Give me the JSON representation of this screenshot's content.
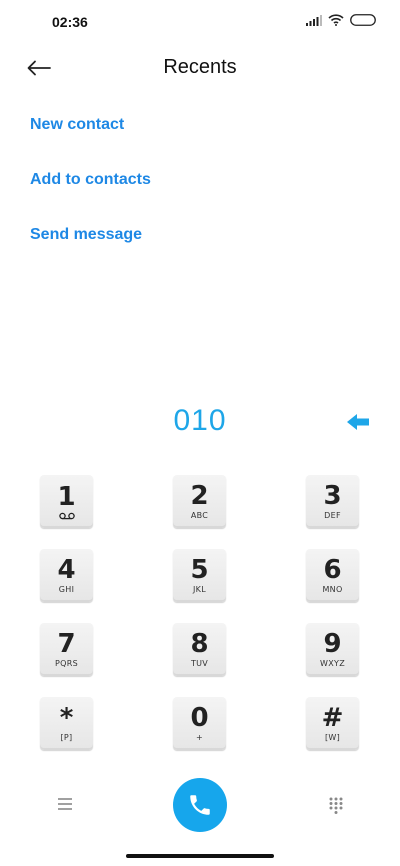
{
  "status_bar": {
    "time": "02:36",
    "icons": [
      "signal-icon",
      "wifi-icon",
      "battery-icon"
    ]
  },
  "header": {
    "title": "Recents",
    "back_icon": "back-arrow-icon"
  },
  "actions": [
    {
      "label": "New contact"
    },
    {
      "label": "Add to contacts"
    },
    {
      "label": "Send message"
    }
  ],
  "dialer": {
    "number": "010",
    "backspace_icon": "backspace-icon"
  },
  "keypad": [
    {
      "digit": "1",
      "letters": "",
      "icon": "voicemail-icon"
    },
    {
      "digit": "2",
      "letters": "ABC"
    },
    {
      "digit": "3",
      "letters": "DEF"
    },
    {
      "digit": "4",
      "letters": "GHI"
    },
    {
      "digit": "5",
      "letters": "JKL"
    },
    {
      "digit": "6",
      "letters": "MNO"
    },
    {
      "digit": "7",
      "letters": "PQRS"
    },
    {
      "digit": "8",
      "letters": "TUV"
    },
    {
      "digit": "9",
      "letters": "WXYZ"
    },
    {
      "digit": "*",
      "letters": "[P]"
    },
    {
      "digit": "0",
      "letters": "+"
    },
    {
      "digit": "#",
      "letters": "[W]"
    }
  ],
  "bottom_bar": {
    "menu_icon": "menu-icon",
    "call_icon": "phone-icon",
    "dialpad_icon": "dialpad-icon"
  },
  "colors": {
    "accent": "#1e88e5",
    "dial_number": "#1ea6e8",
    "call_button": "#16a6ec"
  }
}
